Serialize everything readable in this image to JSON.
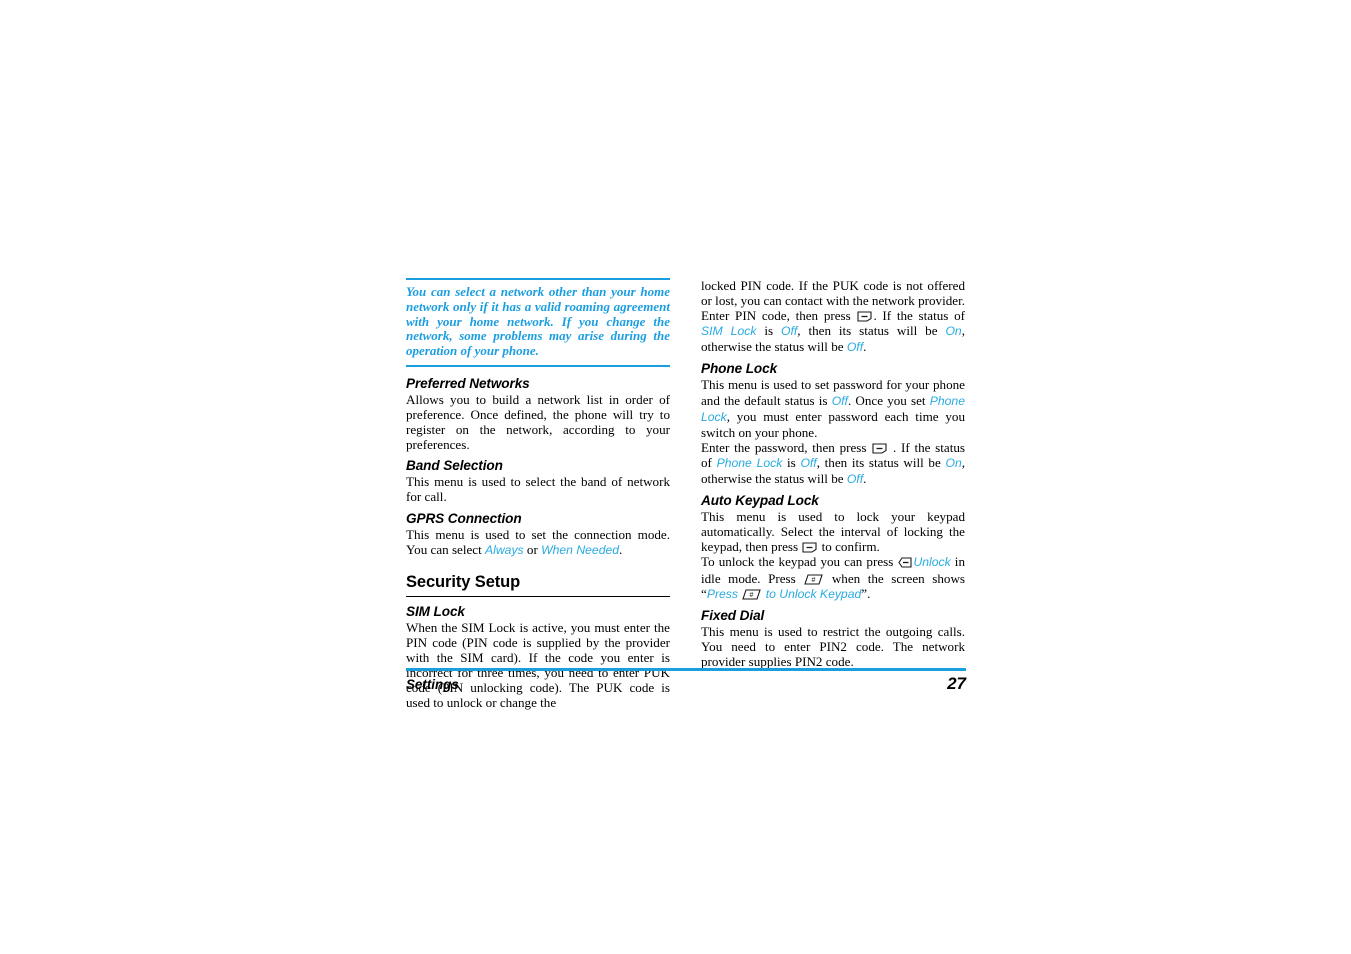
{
  "document": {
    "footer": {
      "section_label": "Settings",
      "page_number": "27"
    },
    "colors": {
      "rule_blue": "#1b9ee0",
      "term_blue": "#29abe2",
      "note_blue": "#1b9ee0",
      "text_black": "#000000"
    }
  },
  "left_column": {
    "note": {
      "text": "You can select a network other than your home network only if it has a valid roaming agreement with your home network. If you change the network, some problems may arise during the operation of your phone."
    },
    "preferred_networks": {
      "heading": "Preferred Networks",
      "body": "Allows you to build a network list in order of preference. Once defined, the phone will try to register on the network, according to your preferences."
    },
    "band_selection": {
      "heading": "Band Selection",
      "body": "This menu is used to select the band of network for call."
    },
    "gprs_connection": {
      "heading": "GPRS Connection",
      "body_before": "This menu is used to set the connection mode. You can select ",
      "term_always": "Always",
      "body_mid": " or ",
      "term_when_needed": "When Needed",
      "body_after": "."
    },
    "security_setup": {
      "heading": "Security Setup"
    },
    "sim_lock": {
      "heading": "SIM Lock",
      "body": "When the SIM Lock is active, you must enter the PIN code (PIN code is supplied by the provider with the SIM card). If the code you enter is incorrect for three times, you need to enter PUK code (PIN unlocking code). The PUK code is used to unlock or change the"
    }
  },
  "right_column": {
    "sim_lock_continued": {
      "body_1": "locked PIN code. If the PUK code is not offered or lost, you can contact with the network provider.",
      "para2_seg1": "Enter PIN code, then press ",
      "para2_seg2": ". If the status of ",
      "term_sim_lock": "SIM Lock",
      "para2_seg3": " is ",
      "term_off_1": "Off",
      "para2_seg4": ", then its status will be ",
      "term_on": "On",
      "para2_seg5": ", otherwise the status will be ",
      "term_off_2": "Off",
      "para2_seg6": "."
    },
    "phone_lock": {
      "heading": "Phone Lock",
      "para1_seg1": "This menu is used to set password for your phone and the default status is ",
      "term_off_1": "Off",
      "para1_seg2": ". Once you set ",
      "term_phone_lock": "Phone Lock",
      "para1_seg3": ", you must enter password each time you switch on your phone.",
      "para2_seg1": "Enter the password, then press ",
      "para2_seg2": " . If the status of ",
      "term_phone_lock_2": "Phone Lock",
      "para2_seg3": " is ",
      "term_off_2": "Off",
      "para2_seg4": ", then its status will be ",
      "term_on": "On",
      "para2_seg5": ", otherwise the status will be ",
      "term_off_3": "Off",
      "para2_seg6": "."
    },
    "auto_keypad_lock": {
      "heading": "Auto Keypad Lock",
      "para1_seg1": "This menu is used to lock your keypad automatically. Select the interval of locking the keypad, then press ",
      "para1_seg2": " to confirm.",
      "para2_seg1": "To unlock the keypad you can press ",
      "term_unlock": "Unlock",
      "para2_seg2": " in idle mode. Press ",
      "para2_seg3": " when the screen shows “",
      "term_press": "Press ",
      "term_to_unlock_keypad": " to Unlock Keypad",
      "para2_seg4": "”."
    },
    "fixed_dial": {
      "heading": "Fixed Dial",
      "body": "This menu is used to restrict the outgoing calls. You need to enter PIN2 code. The network provider supplies PIN2 code."
    }
  },
  "icons": {
    "softkey_dash": "softkey-dash-icon",
    "softkey_left": "softkey-left-icon",
    "hash_key": "hash-key-icon"
  }
}
